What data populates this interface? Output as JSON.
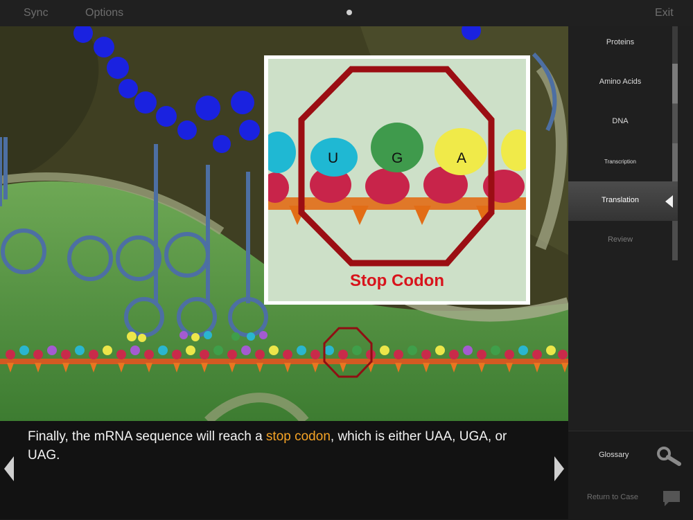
{
  "topbar": {
    "sync_label": "Sync",
    "options_label": "Options",
    "exit_label": "Exit"
  },
  "nav": {
    "items": [
      {
        "label": "Proteins"
      },
      {
        "label": "Amino Acids"
      },
      {
        "label": "DNA"
      },
      {
        "label": "Transcription"
      },
      {
        "label": "Translation"
      },
      {
        "label": "Review"
      }
    ],
    "active": "Translation"
  },
  "side_bottom": {
    "glossary_label": "Glossary",
    "return_label": "Return to Case"
  },
  "inset": {
    "title": "Stop Codon",
    "codon_letters": [
      "U",
      "G",
      "A"
    ]
  },
  "caption": {
    "text_before": "Finally, the mRNA sequence will reach a ",
    "highlight": "stop codon",
    "text_after": ", which is either UAA, UGA, or UAG."
  },
  "colors": {
    "highlight": "#f5a326",
    "stop_sign": "#a00d12",
    "stop_label": "#d8141c",
    "background_scene": "#4e8a3c"
  }
}
